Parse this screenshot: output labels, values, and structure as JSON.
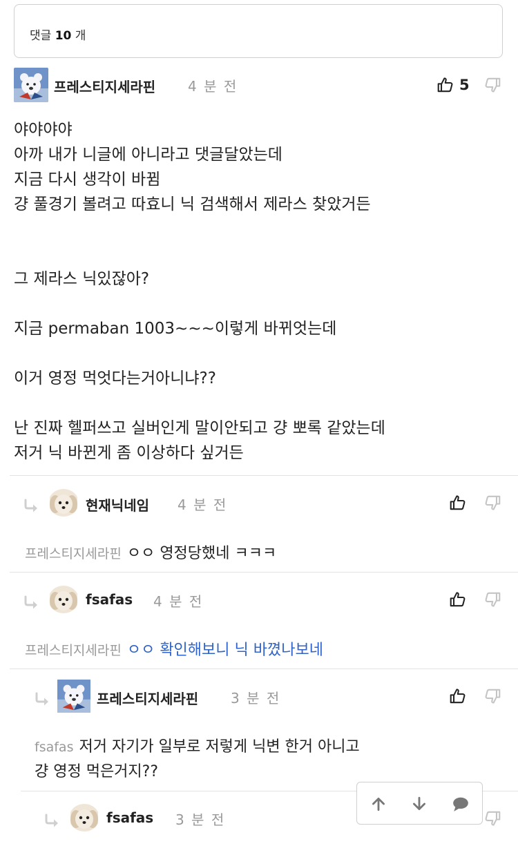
{
  "header": {
    "prefix": "댓글",
    "count": "10",
    "suffix": "개"
  },
  "main_comment": {
    "author": "프레스티지세라핀",
    "time": "4 분 전",
    "likes": "5",
    "text": "야야야야\n아까 내가 니글에 아니라고 댓글달았는데\n지금 다시 생각이 바뀜\n걍 풀경기 볼려고 따효니 닉 검색해서 제라스 찾았거든\n\n\n그 제라스 닉있잖아?\n\n지금 permaban 1003~~~이렇게 바뀌엇는데\n\n이거 영정 먹엇다는거아니냐??\n\n난 진짜 헬퍼쓰고 실버인게 말이안되고 걍 뽀록 같았는데\n저거 닉 바뀐게 좀 이상하다 싶거든"
  },
  "replies": [
    {
      "author": "현재닉네임",
      "time": "4 분 전",
      "mention": "프레스티지세라핀",
      "text": "ㅇㅇ 영정당했네 ㅋㅋㅋ"
    },
    {
      "author": "fsafas",
      "time": "4 분 전",
      "mention": "프레스티지세라핀",
      "text": "ㅇㅇ 확인해보니 닉 바꼈나보네"
    },
    {
      "author": "프레스티지세라핀",
      "time": "3 분 전",
      "mention": "fsafas",
      "text_line1": "저거 자기가 일부로 저렇게 닉변 한거 아니고",
      "text_line2": "걍 영정 먹은거지??"
    },
    {
      "author": "fsafas",
      "time": "3 분 전"
    }
  ],
  "colors": {
    "link": "#2f63c8",
    "muted": "#999999",
    "border": "#cfcfcf"
  },
  "icons": [
    "thumbs-up-icon",
    "thumbs-down-icon",
    "reply-arrow-icon",
    "arrow-up-icon",
    "arrow-down-icon",
    "comment-bubble-icon"
  ]
}
